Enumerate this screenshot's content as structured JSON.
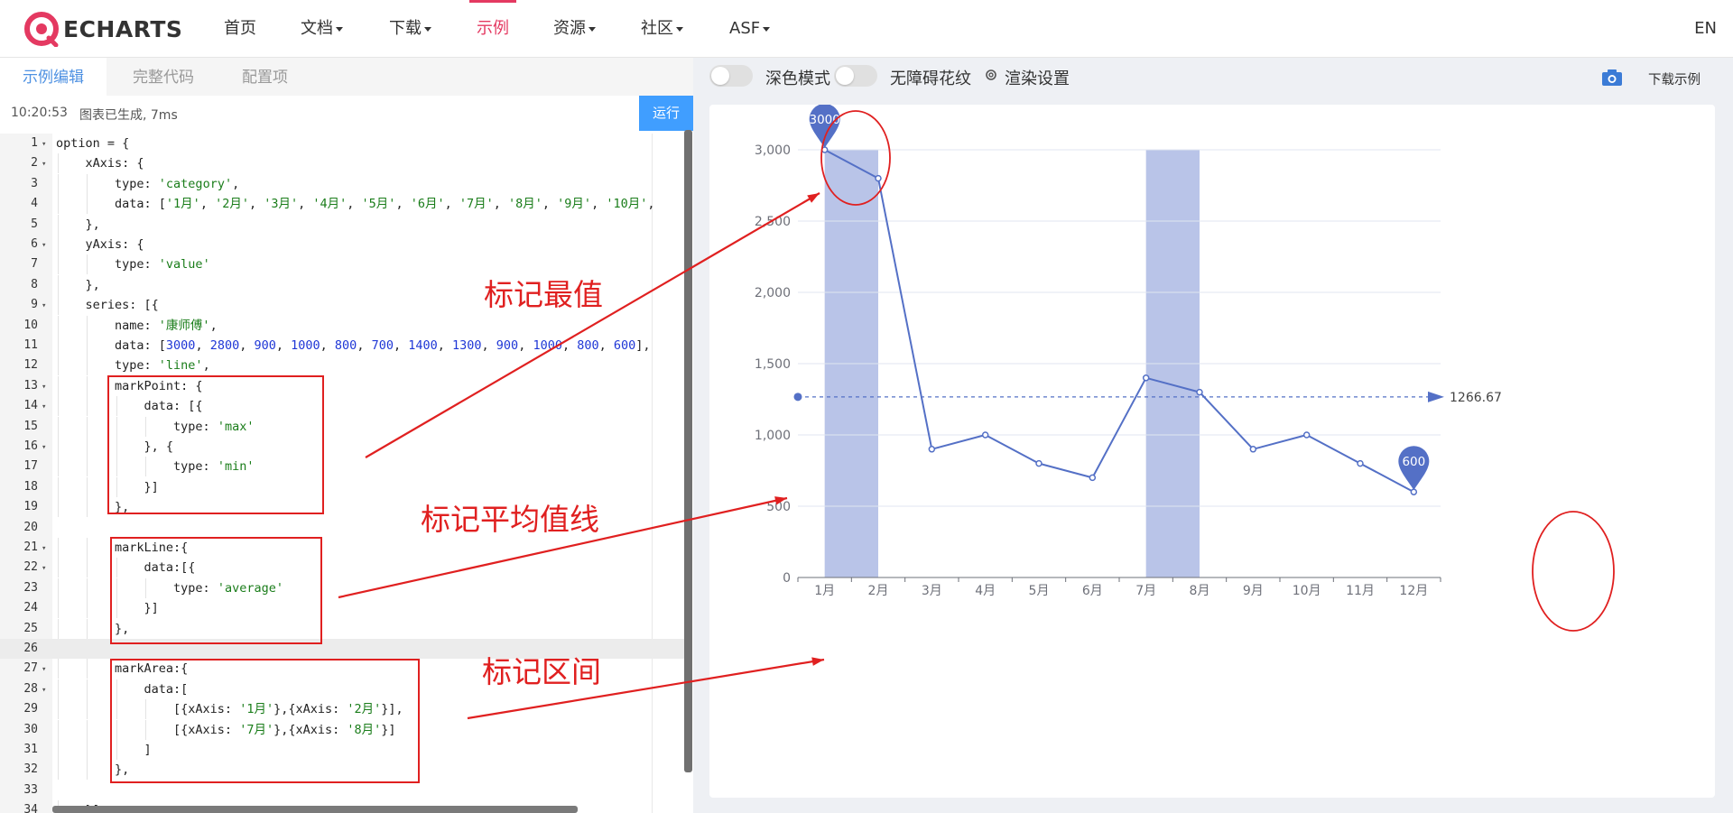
{
  "nav": {
    "logo_text": "ECHARTS",
    "items": [
      {
        "label": "首页",
        "dropdown": false,
        "active": false
      },
      {
        "label": "文档",
        "dropdown": true,
        "active": false
      },
      {
        "label": "下载",
        "dropdown": true,
        "active": false
      },
      {
        "label": "示例",
        "dropdown": false,
        "active": true
      },
      {
        "label": "资源",
        "dropdown": true,
        "active": false
      },
      {
        "label": "社区",
        "dropdown": true,
        "active": false
      },
      {
        "label": "ASF",
        "dropdown": true,
        "active": false
      }
    ],
    "lang": "EN",
    "accent_color": "#e43961"
  },
  "editor_tabs": [
    {
      "label": "示例编辑",
      "active": true
    },
    {
      "label": "完整代码",
      "active": false
    },
    {
      "label": "配置项",
      "active": false
    }
  ],
  "status": {
    "time": "10:20:53",
    "message": "图表已生成, 7ms",
    "run_label": "运行",
    "run_color": "#409eff"
  },
  "code_lines": [
    "option = {",
    "    xAxis: {",
    "        type: 'category',",
    "        data: ['1月', '2月', '3月', '4月', '5月', '6月', '7月', '8月', '9月', '10月',",
    "    },",
    "    yAxis: {",
    "        type: 'value'",
    "    },",
    "    series: [{",
    "        name: '康师傅',",
    "        data: [3000, 2800, 900, 1000, 800, 700, 1400, 1300, 900, 1000, 800, 600],",
    "        type: 'line',",
    "        markPoint: {",
    "            data: [{",
    "                type: 'max'",
    "            }, {",
    "                type: 'min'",
    "            }]",
    "        },",
    "",
    "        markLine:{",
    "            data:[{",
    "                type: 'average'",
    "            }]",
    "        },",
    "",
    "        markArea:{",
    "            data:[",
    "                [{xAxis: '1月'},{xAxis: '2月'}],",
    "                [{xAxis: '7月'},{xAxis: '8月'}]",
    "            ]",
    "        },",
    "",
    "    }]"
  ],
  "foldable_lines": [
    1,
    2,
    6,
    9,
    13,
    14,
    16,
    21,
    22,
    27,
    28
  ],
  "highlighted_line": 26,
  "annotations": [
    {
      "label": "标记最值"
    },
    {
      "label": "标记平均值线"
    },
    {
      "label": "标记区间"
    }
  ],
  "annotation_color": "#e02020",
  "toolbar": {
    "dark_mode_label": "深色模式",
    "accessible_label": "无障碍花纹",
    "render_settings_label": "渲染设置",
    "download_label": "下载示例"
  },
  "chart_data": {
    "type": "line",
    "categories": [
      "1月",
      "2月",
      "3月",
      "4月",
      "5月",
      "6月",
      "7月",
      "8月",
      "9月",
      "10月",
      "11月",
      "12月"
    ],
    "series": [
      {
        "name": "康师傅",
        "values": [
          3000,
          2800,
          900,
          1000,
          800,
          700,
          1400,
          1300,
          900,
          1000,
          800,
          600
        ],
        "color": "#5470c6"
      }
    ],
    "ylim": [
      0,
      3000
    ],
    "yticks": [
      0,
      500,
      1000,
      1500,
      2000,
      2500,
      3000
    ],
    "ytick_labels": [
      "0",
      "500",
      "1,000",
      "1,500",
      "2,000",
      "2,500",
      "3,000"
    ],
    "mark_points": [
      {
        "label": "3000",
        "category": "1月",
        "value": 3000
      },
      {
        "label": "600",
        "category": "12月",
        "value": 600
      }
    ],
    "mark_line": {
      "label": "1266.67",
      "value": 1266.67
    },
    "mark_areas": [
      {
        "from": "1月",
        "to": "2月"
      },
      {
        "from": "7月",
        "to": "8月"
      }
    ],
    "area_color": "#b9c4e8",
    "grid": true
  }
}
